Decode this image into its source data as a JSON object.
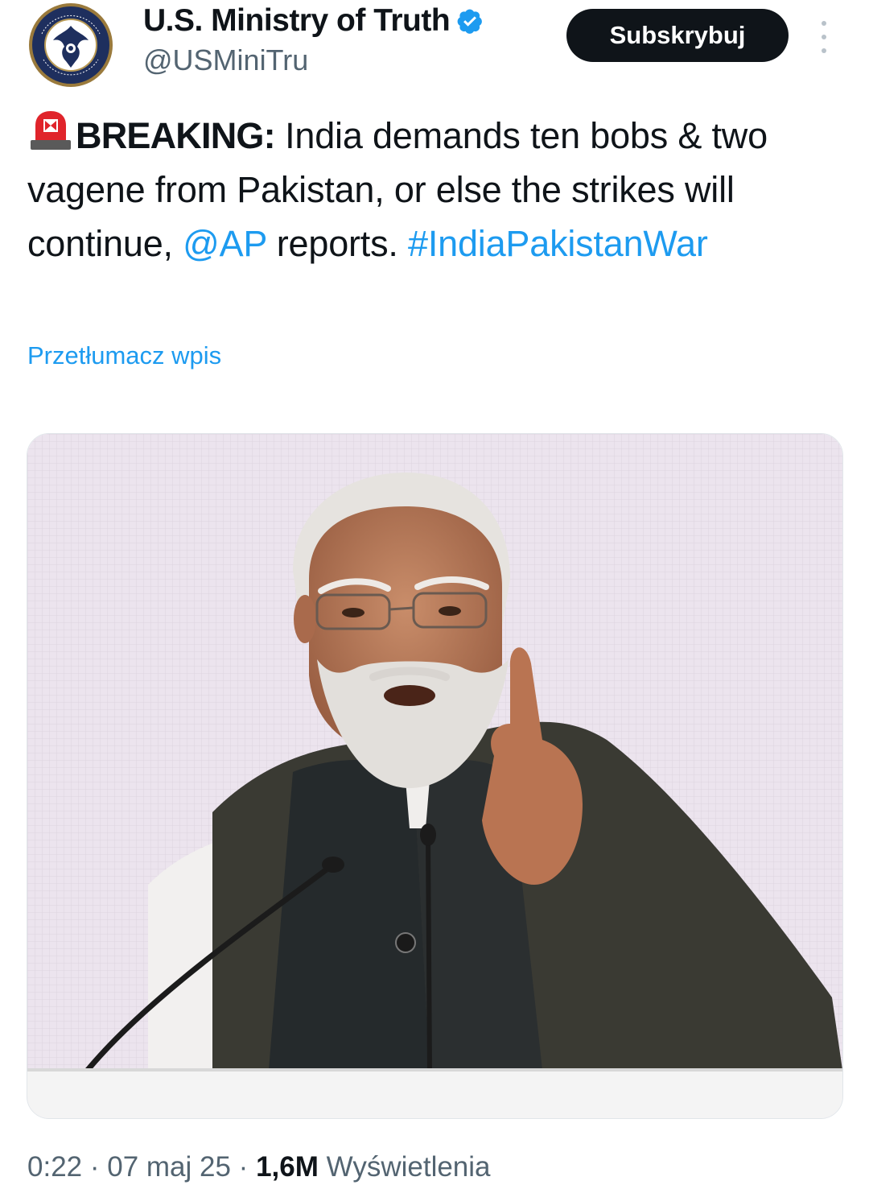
{
  "author": {
    "display_name": "U.S. Ministry of Truth",
    "handle": "@USMiniTru",
    "verified": true,
    "avatar_text": "U.S. DISINFORMATION GOVERNANCE BOARD"
  },
  "subscribe_label": "Subskrybuj",
  "tweet": {
    "emoji": "siren-icon",
    "breaking": "BREAKING:",
    "text_1": " India demands ten bobs & two vagene from Pakistan, or else the strikes will continue, ",
    "mention": "@AP",
    "text_2": " reports. ",
    "hashtag": "#IndiaPakistanWar"
  },
  "translate_label": "Przetłumacz wpis",
  "meta": {
    "time": "0:22",
    "sep1": " · ",
    "date": "07 maj 25",
    "sep2": " · ",
    "views": "1,6M",
    "views_label": " Wyświetlenia"
  },
  "colors": {
    "link": "#1d9bf0",
    "text": "#0f1419",
    "muted": "#536471",
    "verified": "#1d9bf0"
  }
}
